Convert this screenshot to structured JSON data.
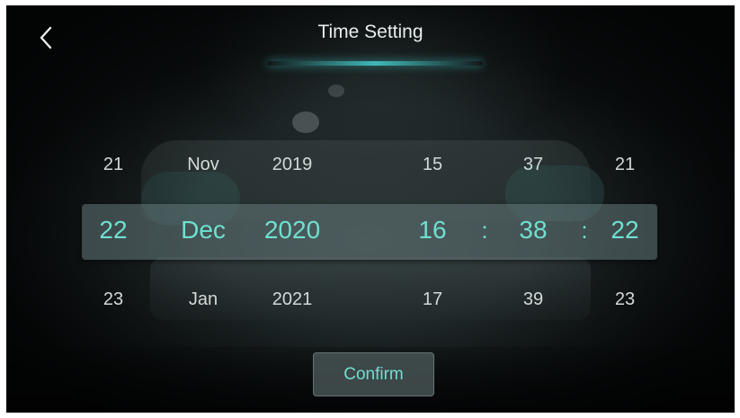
{
  "header": {
    "title": "Time Setting",
    "back_icon": "chevron-left-icon"
  },
  "colors": {
    "accent": "#6fe0d0",
    "text": "#e8eded"
  },
  "picker": {
    "columns": [
      {
        "name": "day",
        "prev": "21",
        "value": "22",
        "next": "23"
      },
      {
        "name": "month",
        "prev": "Nov",
        "value": "Dec",
        "next": "Jan"
      },
      {
        "name": "year",
        "prev": "2019",
        "value": "2020",
        "next": "2021"
      },
      {
        "name": "hour",
        "prev": "15",
        "value": "16",
        "next": "17"
      },
      {
        "name": "minute",
        "prev": "37",
        "value": "38",
        "next": "39"
      },
      {
        "name": "second",
        "prev": "21",
        "value": "22",
        "next": "23"
      }
    ],
    "separators": [
      ":",
      ":"
    ]
  },
  "confirm_label": "Confirm"
}
